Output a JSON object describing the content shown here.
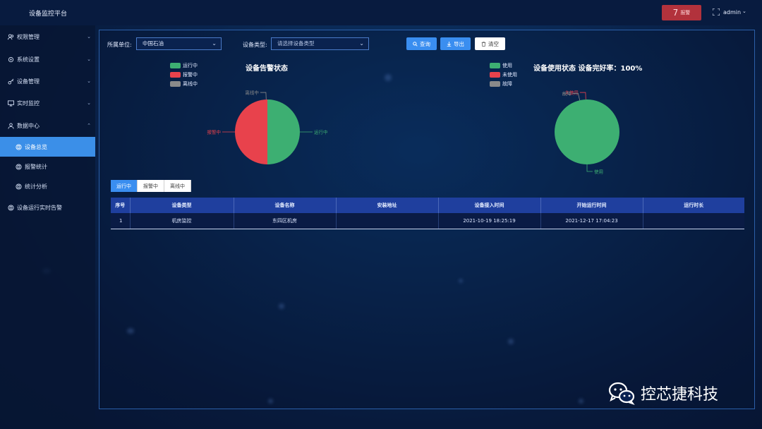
{
  "header": {
    "title": "设备监控平台",
    "alarm_count": "7",
    "alarm_label": "报警",
    "user": "admin"
  },
  "sidebar": {
    "items": [
      {
        "label": "权限管理",
        "icon": "users-icon"
      },
      {
        "label": "系统设置",
        "icon": "gear-icon"
      },
      {
        "label": "设备管理",
        "icon": "key-icon"
      },
      {
        "label": "实时监控",
        "icon": "monitor-icon"
      },
      {
        "label": "数据中心",
        "icon": "person-icon"
      },
      {
        "label": "设备总览",
        "icon": "circle-icon",
        "active": true
      },
      {
        "label": "报警统计",
        "icon": "circle-icon"
      },
      {
        "label": "统计分析",
        "icon": "circle-icon"
      },
      {
        "label": "设备运行实时告警",
        "icon": "circle-icon"
      }
    ]
  },
  "filters": {
    "unit_label": "所属单位:",
    "unit_value": "中国石油",
    "type_label": "设备类型:",
    "type_placeholder": "请选择设备类型",
    "search_label": "查询",
    "export_label": "导出",
    "clear_label": "清空"
  },
  "chart_data": [
    {
      "type": "pie",
      "title": "设备告警状态",
      "legend": [
        "运行中",
        "报警中",
        "离线中"
      ],
      "categories": [
        "运行中",
        "报警中",
        "离线中"
      ],
      "values": [
        1,
        1,
        0
      ],
      "colors": [
        "#3daf72",
        "#e8424c",
        "#8a8a8a"
      ],
      "legend_position": "top-left"
    },
    {
      "type": "pie",
      "title": "设备使用状态 设备完好率：100%",
      "legend": [
        "使用",
        "未使用",
        "故障"
      ],
      "categories": [
        "使用",
        "未使用",
        "故障"
      ],
      "values": [
        1,
        0,
        0
      ],
      "colors": [
        "#3daf72",
        "#e8424c",
        "#8a8a8a"
      ],
      "legend_position": "top-left"
    }
  ],
  "tabs": [
    "运行中",
    "报警中",
    "离线中"
  ],
  "table": {
    "headers": [
      "序号",
      "设备类型",
      "设备名称",
      "安装地址",
      "设备接入时间",
      "开始运行时间",
      "运行时长"
    ],
    "rows": [
      [
        "1",
        "机房监控",
        "东四区机房",
        "",
        "2021-10-19 18:25:19",
        "2021-12-17 17:04:23",
        ""
      ]
    ]
  },
  "watermark": "控芯捷科技",
  "colors": {
    "accent": "#3a8ef0",
    "alarm": "#b2323c",
    "table_header": "#1f3f9e"
  }
}
